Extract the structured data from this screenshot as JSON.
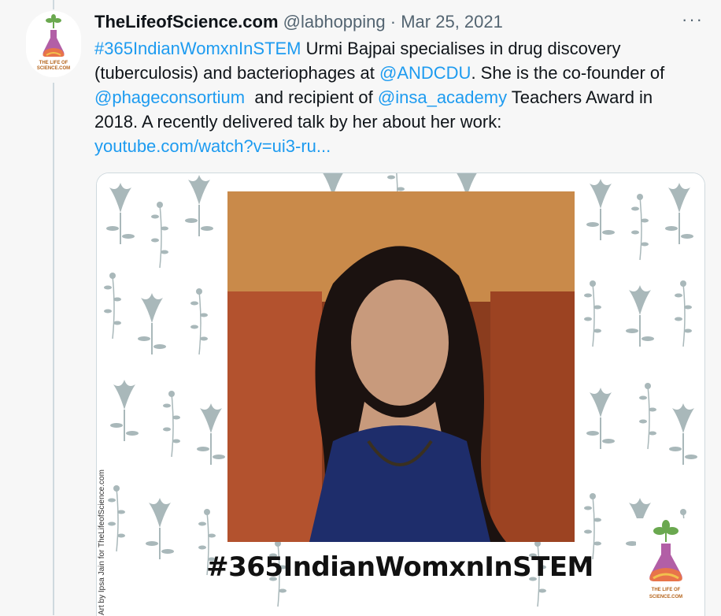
{
  "tweet": {
    "display_name": "TheLifeofScience.com",
    "handle": "@labhopping",
    "separator": "·",
    "date": "Mar 25, 2021",
    "more_label": "···",
    "body": {
      "hashtag": "#365IndianWomxnInSTEM",
      "t1": " Urmi Bajpai specialises in drug discovery",
      "t2": "(tuberculosis) and bacteriophages at ",
      "mention_andcdu": "@ANDCDU",
      "t3": ". She is the co-founder of",
      "mention_phage": "@phageconsortium",
      "t4": "  and recipient of ",
      "mention_insa": "@insa_academy",
      "t5": " Teachers Award in",
      "t6": "2018. A recently delivered talk by her about her work:",
      "url": "youtube.com/watch?v=ui3-ru..."
    }
  },
  "media": {
    "banner_hashtag": "#365IndianWomxnInSTEM",
    "credit": "Art by Ipsa Jain for TheLifeofScience.com",
    "logo_text_line1": "THE LIFE OF",
    "logo_text_line2": "SCIENCE.COM"
  },
  "colors": {
    "link": "#1d9bf0",
    "secondary_text": "#536471",
    "pattern": "#a9b8ba",
    "background": "#f7f7f7"
  },
  "icons": {
    "more": "more-options-icon",
    "avatar_logo": "flask-plant-logo-icon"
  }
}
